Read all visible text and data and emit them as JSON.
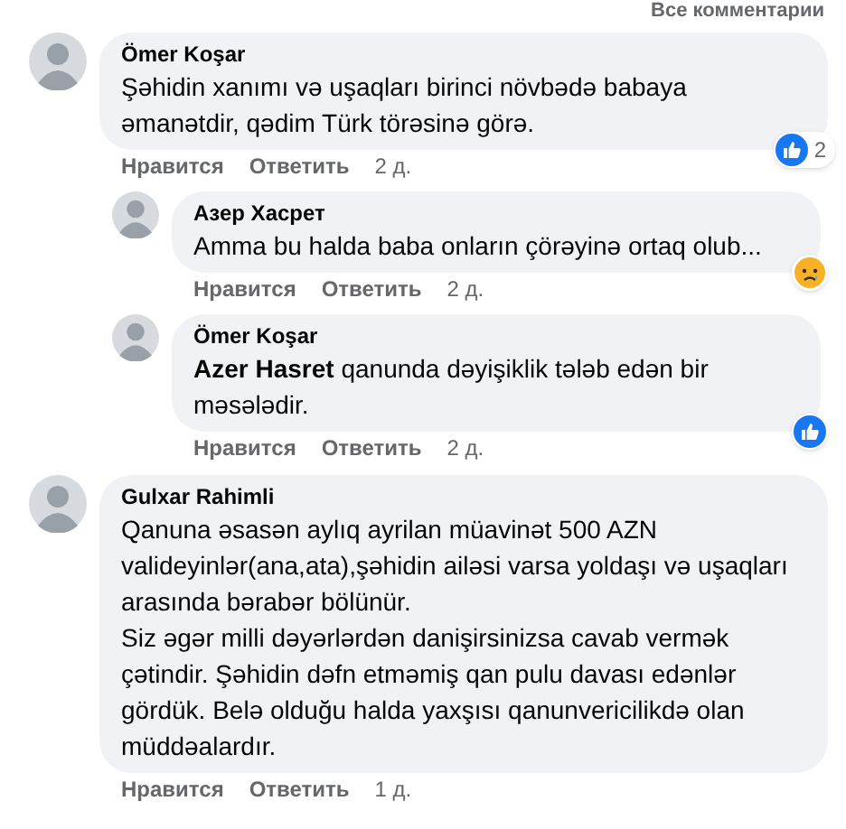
{
  "header_link": "Все комментарии",
  "comments": [
    {
      "author": "Ömer Koşar",
      "text": "Şəhidin xanımı və uşaqları birinci növbədə babaya əmanətdir, qədim Türk törəsinə görə.",
      "reaction": {
        "kind": "like",
        "count": "2"
      },
      "like_label": "Нравится",
      "reply_label": "Ответить",
      "time": "2 д.",
      "children": [
        {
          "author": "Азер Хасрет",
          "text": "Amma bu halda baba onların çörəyinə ortaq olub...",
          "reaction": {
            "kind": "sad"
          },
          "like_label": "Нравится",
          "reply_label": "Ответить",
          "time": "2 д."
        },
        {
          "author": "Ömer Koşar",
          "text": "**Azer Hasret** qanunda dəyişiklik tələb edən bir məsələdir.",
          "reaction": {
            "kind": "like"
          },
          "like_label": "Нравится",
          "reply_label": "Ответить",
          "time": "2 д."
        }
      ]
    },
    {
      "author": "Gulxar Rahimli",
      "text": "Qanuna əsasən aylıq ayrilan müavinət 500 AZN valideyinlər(ana,ata),şəhidin ailəsi varsa yoldaşı və uşaqları arasında bərabər bölünür.\nSiz əgər milli dəyərlərdən danişirsinizsa cavab vermək çətindir. Şəhidin dəfn etməmiş qan pulu davası edənlər gördük. Belə olduğu halda yaxşısı qanunvericilikdə olan müddəalardır.",
      "like_label": "Нравится",
      "reply_label": "Ответить",
      "time": "1 д."
    }
  ]
}
